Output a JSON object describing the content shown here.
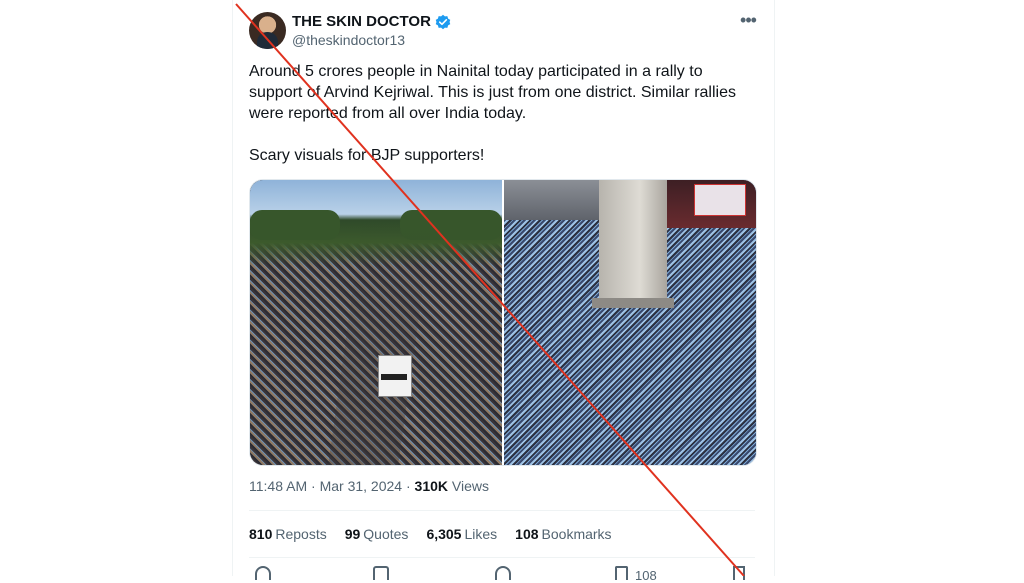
{
  "tweet": {
    "author": {
      "name": "THE SKIN DOCTOR",
      "handle": "@theskindoctor13",
      "verified": true,
      "verified_color": "#1d9bf0"
    },
    "text": "Around 5 crores people in Nainital today participated in a rally to support of Arvind Kejriwal. This is just from one district. Similar rallies were reported from all over India today.\n\nScary visuals for BJP supporters!",
    "media": {
      "photo_left_icon": "crowd-street-photo",
      "photo_right_icon": "crowd-obelisk-photo"
    },
    "meta": {
      "time": "11:48 AM",
      "separator": " · ",
      "date": "Mar 31, 2024",
      "views_count": "310K",
      "views_label": " Views"
    },
    "stats": [
      {
        "count": "810",
        "label": "Reposts"
      },
      {
        "count": "99",
        "label": "Quotes"
      },
      {
        "count": "6,305",
        "label": "Likes"
      },
      {
        "count": "108",
        "label": "Bookmarks"
      }
    ],
    "actions": {
      "reply_icon": "reply-icon",
      "repost_icon": "repost-icon",
      "like_icon": "heart-icon",
      "bookmark_icon": "bookmark-icon",
      "bookmark_count": "108",
      "share_icon": "share-icon"
    },
    "more_icon": "more-options-icon"
  },
  "overlay": {
    "type": "strike-through-line",
    "color": "#e0321f"
  }
}
